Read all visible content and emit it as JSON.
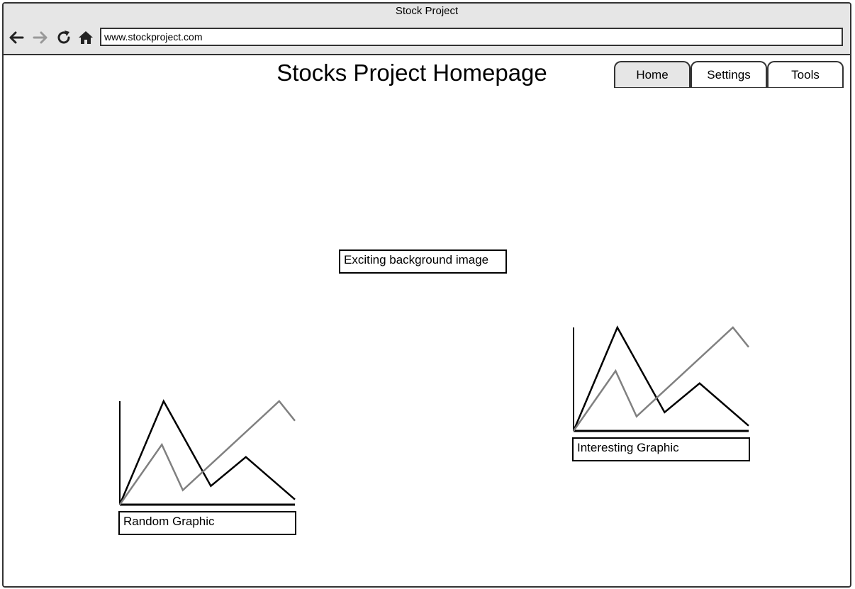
{
  "window": {
    "title": "Stock Project"
  },
  "toolbar": {
    "back_icon": "arrow-left-icon",
    "forward_icon": "arrow-right-icon",
    "reload_icon": "reload-icon",
    "home_icon": "home-icon",
    "url": "www.stockproject.com"
  },
  "page": {
    "title": "Stocks Project Homepage"
  },
  "tabs": [
    {
      "label": "Home",
      "active": true
    },
    {
      "label": "Settings",
      "active": false
    },
    {
      "label": "Tools",
      "active": false
    }
  ],
  "hero": {
    "placeholder_label": "Exciting background image"
  },
  "graphics": [
    {
      "caption": "Random Graphic",
      "series": [
        {
          "color": "#000000",
          "points": [
            [
              0,
              0
            ],
            [
              25,
              100
            ],
            [
              52,
              18
            ],
            [
              72,
              46
            ],
            [
              100,
              5
            ]
          ]
        },
        {
          "color": "#808080",
          "points": [
            [
              0,
              0
            ],
            [
              24,
              58
            ],
            [
              36,
              14
            ],
            [
              91,
              100
            ],
            [
              100,
              81
            ]
          ]
        }
      ]
    },
    {
      "caption": "Interesting Graphic",
      "series": [
        {
          "color": "#000000",
          "points": [
            [
              0,
              0
            ],
            [
              25,
              100
            ],
            [
              52,
              18
            ],
            [
              72,
              46
            ],
            [
              100,
              5
            ]
          ]
        },
        {
          "color": "#808080",
          "points": [
            [
              0,
              0
            ],
            [
              24,
              58
            ],
            [
              36,
              14
            ],
            [
              91,
              100
            ],
            [
              100,
              81
            ]
          ]
        }
      ]
    }
  ],
  "colors": {
    "chrome_bg": "#e6e6e6",
    "border": "#333333",
    "series_primary": "#000000",
    "series_secondary": "#808080"
  }
}
